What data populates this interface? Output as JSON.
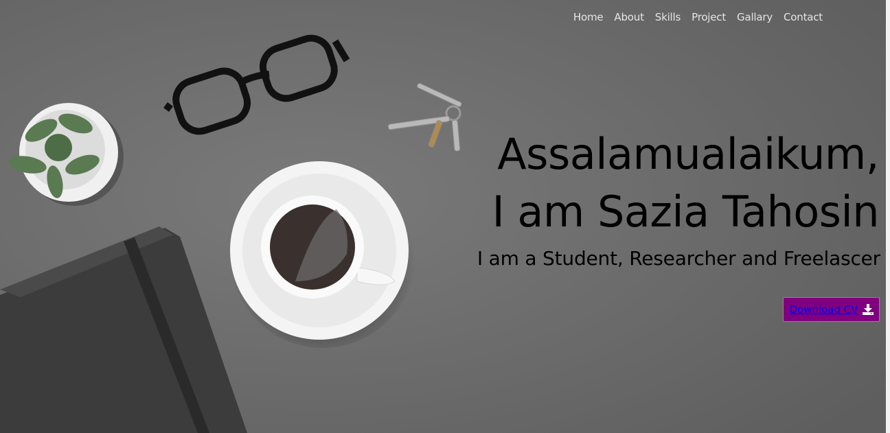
{
  "nav": {
    "items": [
      {
        "label": "Home"
      },
      {
        "label": "About"
      },
      {
        "label": "Skills"
      },
      {
        "label": "Project"
      },
      {
        "label": "Gallary"
      },
      {
        "label": "Contact"
      }
    ]
  },
  "hero": {
    "line1": "Assalamualaikum,",
    "line2": "I am Sazia Tahosin",
    "subtitle": "I am a Student, Researcher and Freelascer",
    "cv_button": {
      "label": "Download CV",
      "icon": "download-icon"
    }
  },
  "colors": {
    "background": "#6b6b6b",
    "button_bg": "#800080",
    "link": "#0000ee",
    "nav_text": "#e6e6e6"
  }
}
